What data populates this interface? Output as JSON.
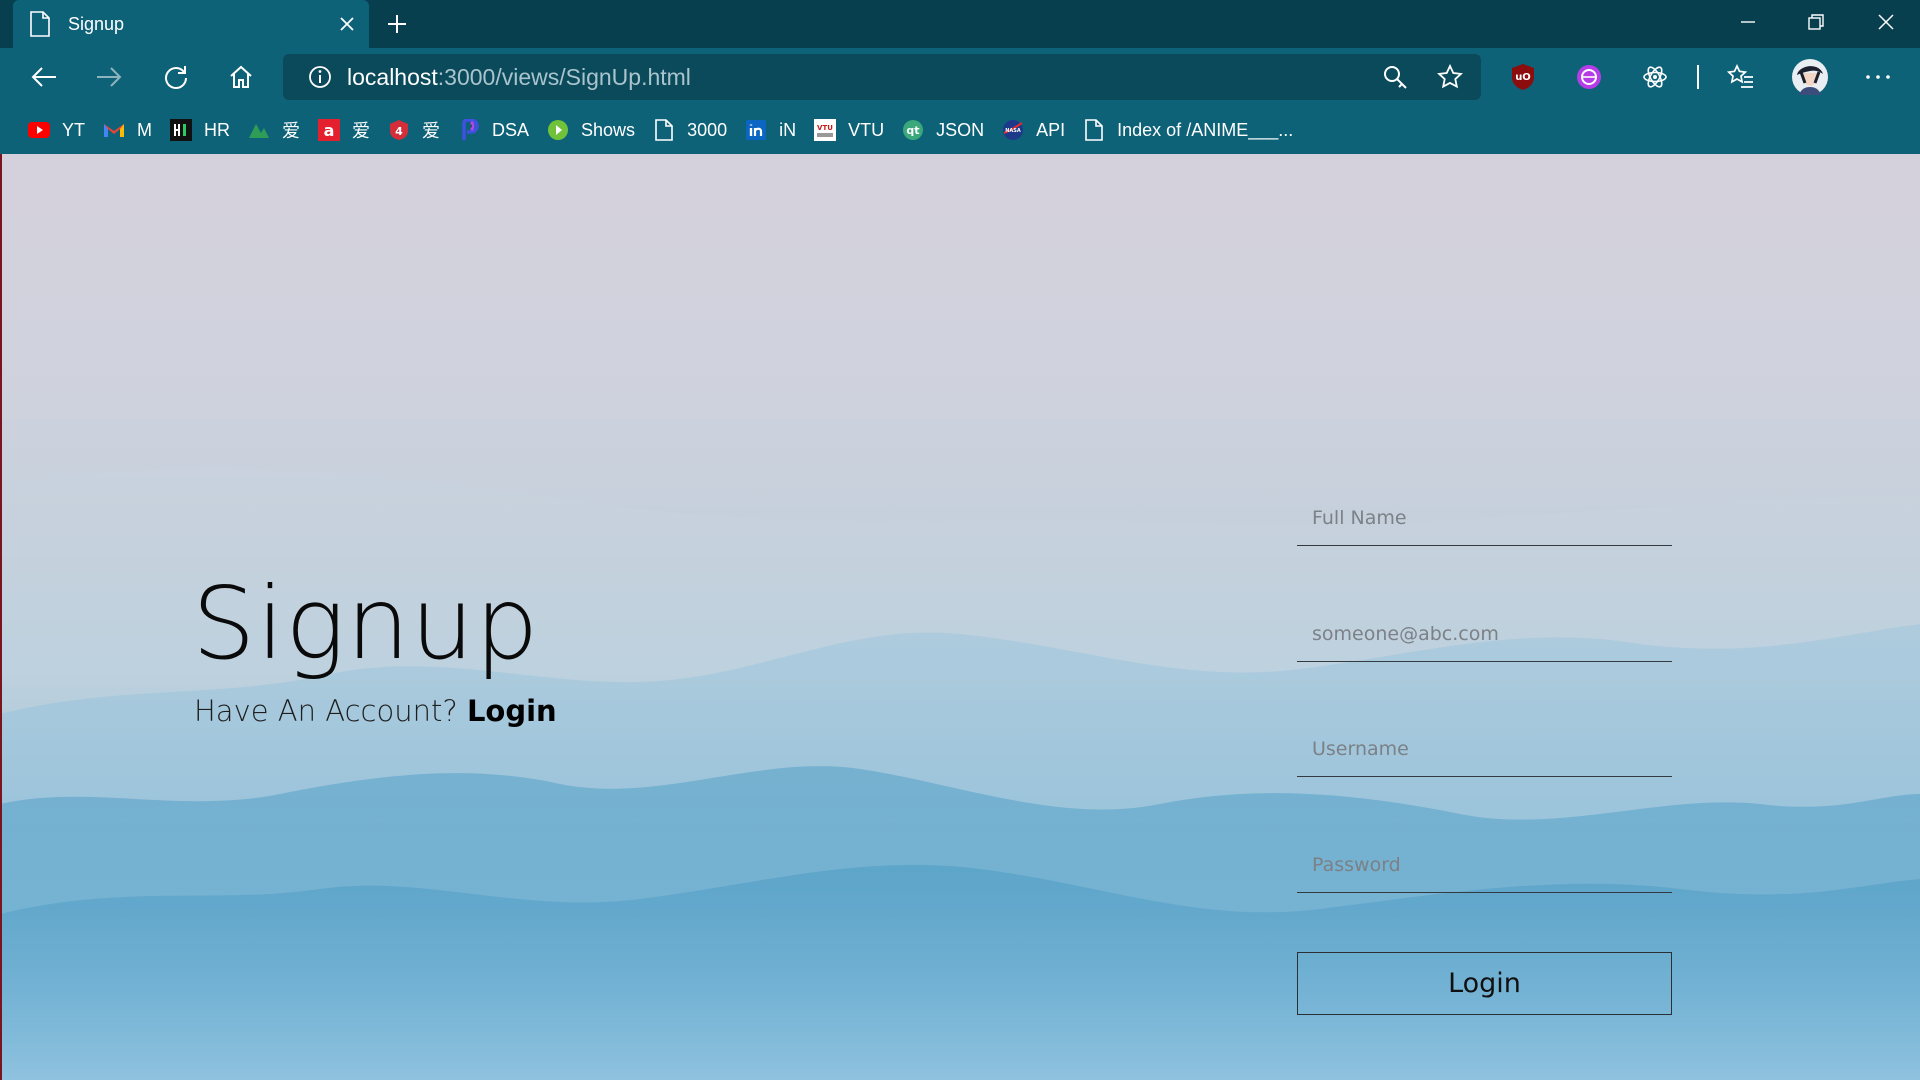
{
  "browser": {
    "tab": {
      "title": "Signup",
      "page_icon": "page-icon",
      "close_icon": "close-icon"
    },
    "new_tab_icon": "plus-icon",
    "window_controls": [
      "minimize-icon",
      "restore-icon",
      "close-icon"
    ],
    "nav_icons": [
      "back-arrow-icon",
      "forward-arrow-icon",
      "refresh-icon",
      "home-icon"
    ],
    "address_bar": {
      "host": "localhost",
      "path": ":3000/views/SignUp.html",
      "info_icon": "info-icon"
    },
    "address_icons": [
      "key-search-icon",
      "star-icon"
    ],
    "extensions": [
      "ublock-icon",
      "purple-extension-icon",
      "react-devtools-icon",
      "favorites-icon",
      "profile-avatar-icon",
      "more-icon"
    ],
    "bookmarks": [
      {
        "label": "YT",
        "icon": "youtube-icon",
        "color": "#ff0000"
      },
      {
        "label": "M",
        "icon": "gmail-icon",
        "color": "#ea4335"
      },
      {
        "label": "HR",
        "icon": "hackerrank-icon",
        "color": "#111111"
      },
      {
        "label": "爱",
        "icon": "green-mountain-icon",
        "color": "#2e9e57"
      },
      {
        "label": "爱",
        "icon": "red-a-icon",
        "color": "#e4202e"
      },
      {
        "label": "爱",
        "icon": "red-shield-icon",
        "color": "#d62d3a"
      },
      {
        "label": "DSA",
        "icon": "blue-p-icon",
        "color": "#3f51e0"
      },
      {
        "label": "Shows",
        "icon": "green-play-icon",
        "color": "#6fc23a"
      },
      {
        "label": "3000",
        "icon": "page-icon",
        "color": "#ffffff"
      },
      {
        "label": "iN",
        "icon": "linkedin-icon",
        "color": "#0a66c2"
      },
      {
        "label": "VTU",
        "icon": "vtu-icon",
        "color": "#ffffff"
      },
      {
        "label": "JSON",
        "icon": "qt-icon",
        "color": "#3aa87b"
      },
      {
        "label": "API",
        "icon": "nasa-icon",
        "color": "#1d3a8a"
      },
      {
        "label": "Index of /ANIME___...",
        "icon": "page-icon",
        "color": "#ffffff"
      }
    ]
  },
  "page": {
    "title": "Signup",
    "subtitle": "Have An Account?",
    "login_link": "Login",
    "form": {
      "full_name_placeholder": "Full Name",
      "email_placeholder": "someone@abc.com",
      "username_placeholder": "Username",
      "password_placeholder": "Password",
      "submit_label": "Login"
    }
  }
}
